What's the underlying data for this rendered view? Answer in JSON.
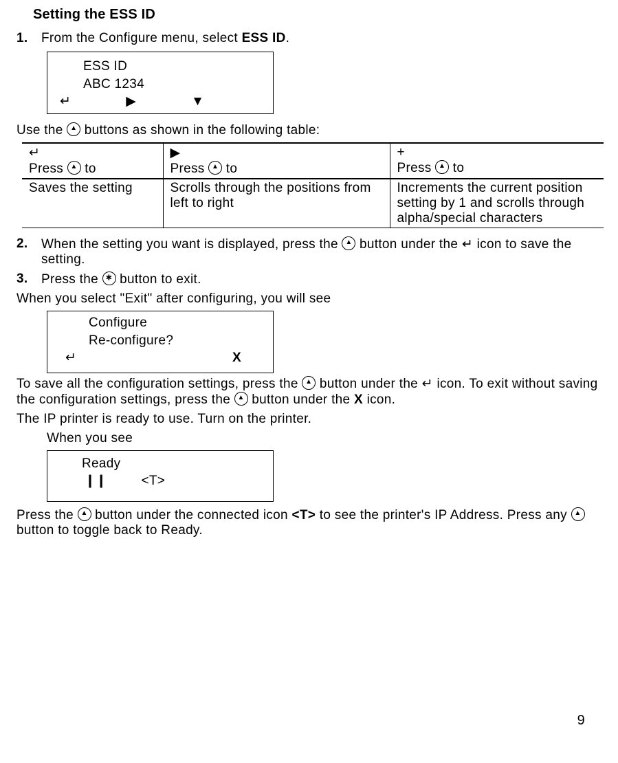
{
  "heading": "Setting the ESS ID",
  "steps": {
    "s1": {
      "num": "1.",
      "text_a": "From the Configure menu, select ",
      "bold": "ESS ID",
      "text_b": "."
    },
    "s2": {
      "num": "2.",
      "text_a": "When the setting you want is displayed, press the ",
      "text_b": " button under the ",
      "icon_after": "↵",
      "text_c": " icon to save the setting."
    },
    "s3": {
      "num": "3.",
      "text_a": "Press the ",
      "text_b": " button to exit."
    }
  },
  "lcd1": {
    "l1": "ESS ID",
    "l2": "ABC 1234",
    "i1": "↵",
    "i2": "▶",
    "i3": "▼"
  },
  "usebuttons": "Use the ",
  "usebuttons2": " buttons as shown in the following table:",
  "table": {
    "h1_sym": "↵",
    "h1": "Press ",
    "h1b": " to",
    "h2_sym": "▶",
    "h2": "Press ",
    "h2b": " to",
    "h3_sym": "+",
    "h3": "Press ",
    "h3b": " to",
    "c1": "Saves the setting",
    "c2": "Scrolls through the positions from left to right",
    "c3": "Increments the current position setting by 1 and scrolls through alpha/special characters"
  },
  "exitline": "When you select \"Exit\" after configuring, you will see",
  "lcd2": {
    "l1": "Configure",
    "l2": "Re-configure?",
    "i1": "↵",
    "i2": "X"
  },
  "save_para_a": "To save all the configuration settings, press the ",
  "save_para_b": " button under the ",
  "save_para_c": " icon.  To exit without saving the configuration settings, press the ",
  "save_para_d": " button under the ",
  "save_para_e": " icon.",
  "x": "X",
  "enter_sym": "↵",
  "ipready": "The IP printer is ready to use.  Turn on the printer.",
  "whenyousee": "When you see",
  "lcd3": {
    "l1": "Ready",
    "i1": "❙❙",
    "i2": "<T>"
  },
  "press_t_a": "Press the ",
  "press_t_b": " button under the connected icon ",
  "press_t_c": " to see the printer's IP Address.  Press any ",
  "press_t_d": " button to toggle back to Ready.",
  "t_tag": "<T>",
  "page": "9",
  "chart_data": {
    "type": "table",
    "columns": [
      "↵ — Press ▲ to",
      "▶ — Press ▲ to",
      "+ — Press ▲ to"
    ],
    "rows": [
      [
        "Saves the setting",
        "Scrolls through the positions from left to right",
        "Increments the current position setting by 1 and scrolls through alpha/special characters"
      ]
    ]
  }
}
